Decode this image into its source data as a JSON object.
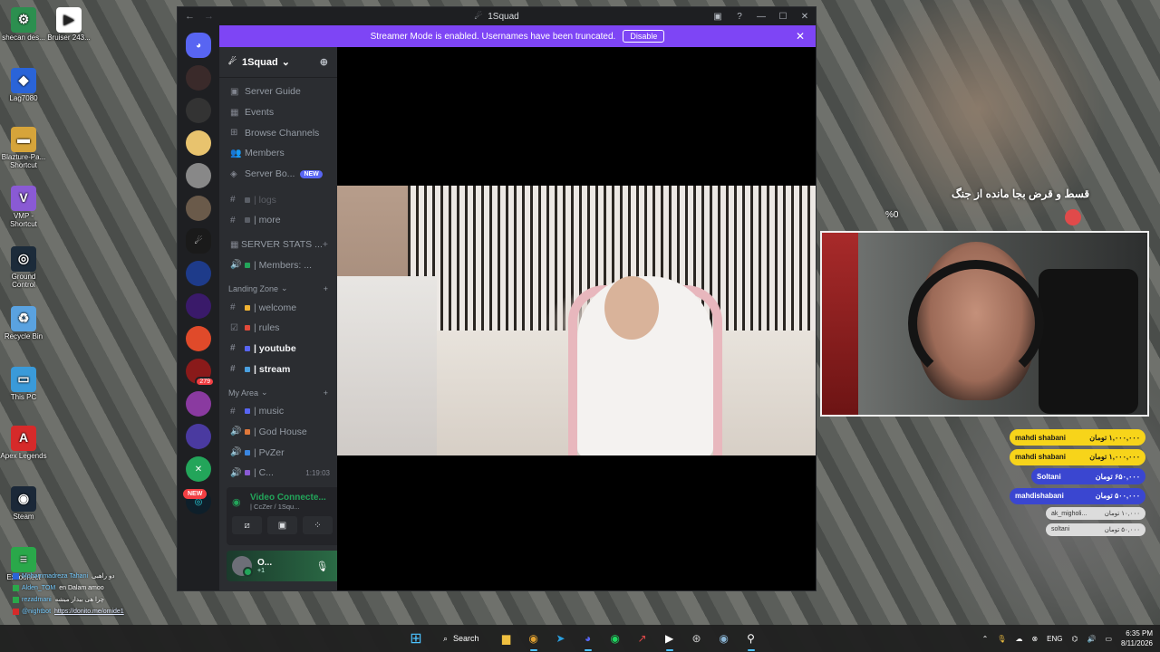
{
  "desktop": {
    "icons": [
      {
        "label": "shecan des...",
        "glyph": "⚙",
        "color": "#2c8f4f"
      },
      {
        "label": "Bruiser 243...",
        "glyph": "▶",
        "color": "#ffffff"
      },
      {
        "label": "Lag7080",
        "glyph": "◆",
        "color": "#2a64d8"
      },
      {
        "label": "Blazture-Pa... Shortcut",
        "glyph": "▬",
        "color": "#d6a43a"
      },
      {
        "label": "VMP - Shortcut",
        "glyph": "V",
        "color": "#8a5ad4"
      },
      {
        "label": "Ground Control",
        "glyph": "◎",
        "color": "#1c2b3a"
      },
      {
        "label": "Recycle Bin",
        "glyph": "♻",
        "color": "#5aa2e0"
      },
      {
        "label": "This PC",
        "glyph": "▭",
        "color": "#3a9ad9"
      },
      {
        "label": "Apex Legends",
        "glyph": "A",
        "color": "#d62a2a"
      },
      {
        "label": "Steam",
        "glyph": "◉",
        "color": "#1b2838"
      },
      {
        "label": "Excoonect",
        "glyph": "≡",
        "color": "#2aa84a"
      }
    ]
  },
  "chat": {
    "lines": [
      {
        "nick": "Mohammadreza Tahani",
        "text": "دو راهبی",
        "marker": "#2a64d8"
      },
      {
        "nick": "Alden_TOM",
        "text": "en Dalam amoo",
        "marker": "#2aa84a"
      },
      {
        "nick": "rezadmani",
        "text": "چرا هی بیدار میشه",
        "marker": "#2aa84a"
      },
      {
        "nick": "@nightbot",
        "text": "",
        "marker": "#d62a2a",
        "link": "https://donito.me/omide1"
      }
    ]
  },
  "discord": {
    "window_title": "1Squad",
    "banner": {
      "text": "Streamer Mode is enabled. Usernames have been truncated.",
      "button": "Disable"
    },
    "server_name": "1Squad",
    "nav_items": [
      {
        "icon": "▣",
        "label": "Server Guide"
      },
      {
        "icon": "▦",
        "label": "Events"
      },
      {
        "icon": "⊞",
        "label": "Browse Channels"
      },
      {
        "icon": "👥",
        "label": "Members"
      },
      {
        "icon": "◈",
        "label": "Server Bo...",
        "badge": "NEW"
      }
    ],
    "channels_top": [
      {
        "icon": "#",
        "label": "| logs",
        "state": "dim"
      },
      {
        "icon": "#",
        "label": "| more",
        "state": "normal"
      }
    ],
    "category_stats": "SERVER STATS ...",
    "stats_channel": "| Members: ...",
    "category_landing": "Landing Zone",
    "landing_channels": [
      {
        "icon": "#",
        "label": "| welcome",
        "state": "normal",
        "emoji_color": "#f0b232"
      },
      {
        "icon": "☑",
        "label": "| rules",
        "state": "normal",
        "emoji_color": "#e04a3a"
      },
      {
        "icon": "#",
        "label": "| youtube",
        "state": "bright",
        "emoji_color": "#5865f2"
      },
      {
        "icon": "#",
        "label": "| stream",
        "state": "bright",
        "emoji_color": "#4aa0e0"
      }
    ],
    "category_myarea": "My Area",
    "myarea_channels": [
      {
        "icon": "#",
        "label": "| music",
        "emoji_color": "#5865f2"
      },
      {
        "icon": "🔊",
        "label": "| God House",
        "emoji_color": "#e0783a"
      },
      {
        "icon": "🔊",
        "label": "| PvZer",
        "emoji_color": "#3a86e0"
      },
      {
        "icon": "🔊",
        "label": "| C...",
        "emoji_color": "#8a5ad4",
        "timer": "1:19:03"
      }
    ],
    "rail_new_badge": "NEW",
    "rail_badge_count": "279",
    "voice": {
      "title": "Video Connecte...",
      "subtitle": "| CcZer / 1Squ..."
    },
    "user": {
      "name": "O...",
      "status": "+1"
    }
  },
  "overlay": {
    "marquee": "قسط و قرض بجا مانده از جنگ",
    "percent": "%0",
    "donations": [
      {
        "name": "mahdi shabani",
        "amount": "۱,۰۰۰,۰۰۰ تومان",
        "style": "yellow"
      },
      {
        "name": "mahdi shabani",
        "amount": "۱,۰۰۰,۰۰۰ تومان",
        "style": "yellow"
      },
      {
        "name": "Soltani",
        "amount": "۶۵۰,۰۰۰ تومان",
        "style": "blue"
      },
      {
        "name": "mahdishabani",
        "amount": "۵۰۰,۰۰۰ تومان",
        "style": "blue"
      },
      {
        "name": "ak_migholi...",
        "amount": "۱۰,۰۰۰ تومان",
        "style": "grey"
      },
      {
        "name": "soltani",
        "amount": "۵۰,۰۰۰ تومان",
        "style": "grey"
      }
    ]
  },
  "taskbar": {
    "search_label": "Search",
    "language": "ENG",
    "time": "6:35 PM",
    "date": "8/11/2026"
  }
}
